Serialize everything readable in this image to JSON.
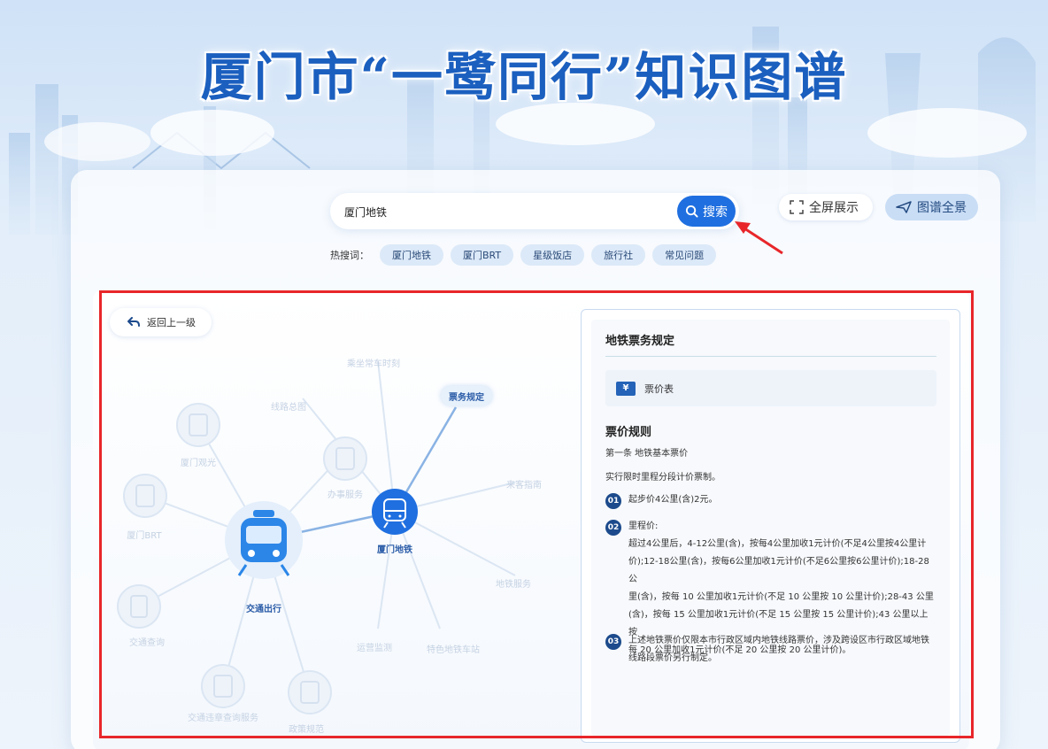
{
  "header": {
    "title": "厦门市“一鹭同行”知识图谱"
  },
  "search": {
    "value": "厦门地铁",
    "button_label": "搜索"
  },
  "toolbar": {
    "fullscreen_label": "全屏展示",
    "graph_overview_label": "图谱全景"
  },
  "hot_search": {
    "label": "热搜词：",
    "tags": [
      "厦门地铁",
      "厦门BRT",
      "星级饭店",
      "旅行社",
      "常见问题"
    ]
  },
  "graph": {
    "back_label": "返回上一级",
    "center_node": "交通出行",
    "focus_node": "厦门地铁",
    "selected_chip": "票务规定",
    "faint_nodes": [
      "乘坐常车时刻",
      "线路总图",
      "厦门观光",
      "办事服务",
      "厦门BRT",
      "交通查询",
      "交通违章查询服务",
      "政策规范",
      "运营监测",
      "特色地铁车站",
      "地铁服务",
      "来客指南"
    ]
  },
  "info_panel": {
    "title": "地铁票务规定",
    "ticket_item": "票价表",
    "ticket_icon": "¥",
    "rules_heading": "票价规则",
    "article": "第一条  地铁基本票价",
    "intro": "实行限时里程分段计价票制。",
    "items": [
      {
        "num": "01",
        "text": "起步价4公里(含)2元。"
      },
      {
        "num": "02",
        "text": "里程价:"
      },
      {
        "num": "03",
        "text": "上述地铁票价仅限本市行政区域内地铁线路票价，涉及跨设区市行政区域地铁线路段票价另行制定。"
      }
    ],
    "item2_lines": [
      "超过4公里后，4-12公里(含)，按每4公里加收1元计价(不足4公里按4公里计",
      "价);12-18公里(含)，按每6公里加收1元计价(不足6公里按6公里计价);18-28 公",
      "里(含)，按每 10 公里加收1元计价(不足 10 公里按 10 公里计价);28-43 公里",
      "(含)，按每 15 公里加收1元计价(不足 15 公里按 15 公里计价);43 公里以上按",
      "每 20 公里加收1元计价(不足 20 公里按 20 公里计价)。"
    ],
    "item3_lines": [
      "上述地铁票价仅限本市行政区域内地铁线路票价，涉及跨设区市行政区域地铁",
      "线路段票价另行制定。"
    ]
  }
}
